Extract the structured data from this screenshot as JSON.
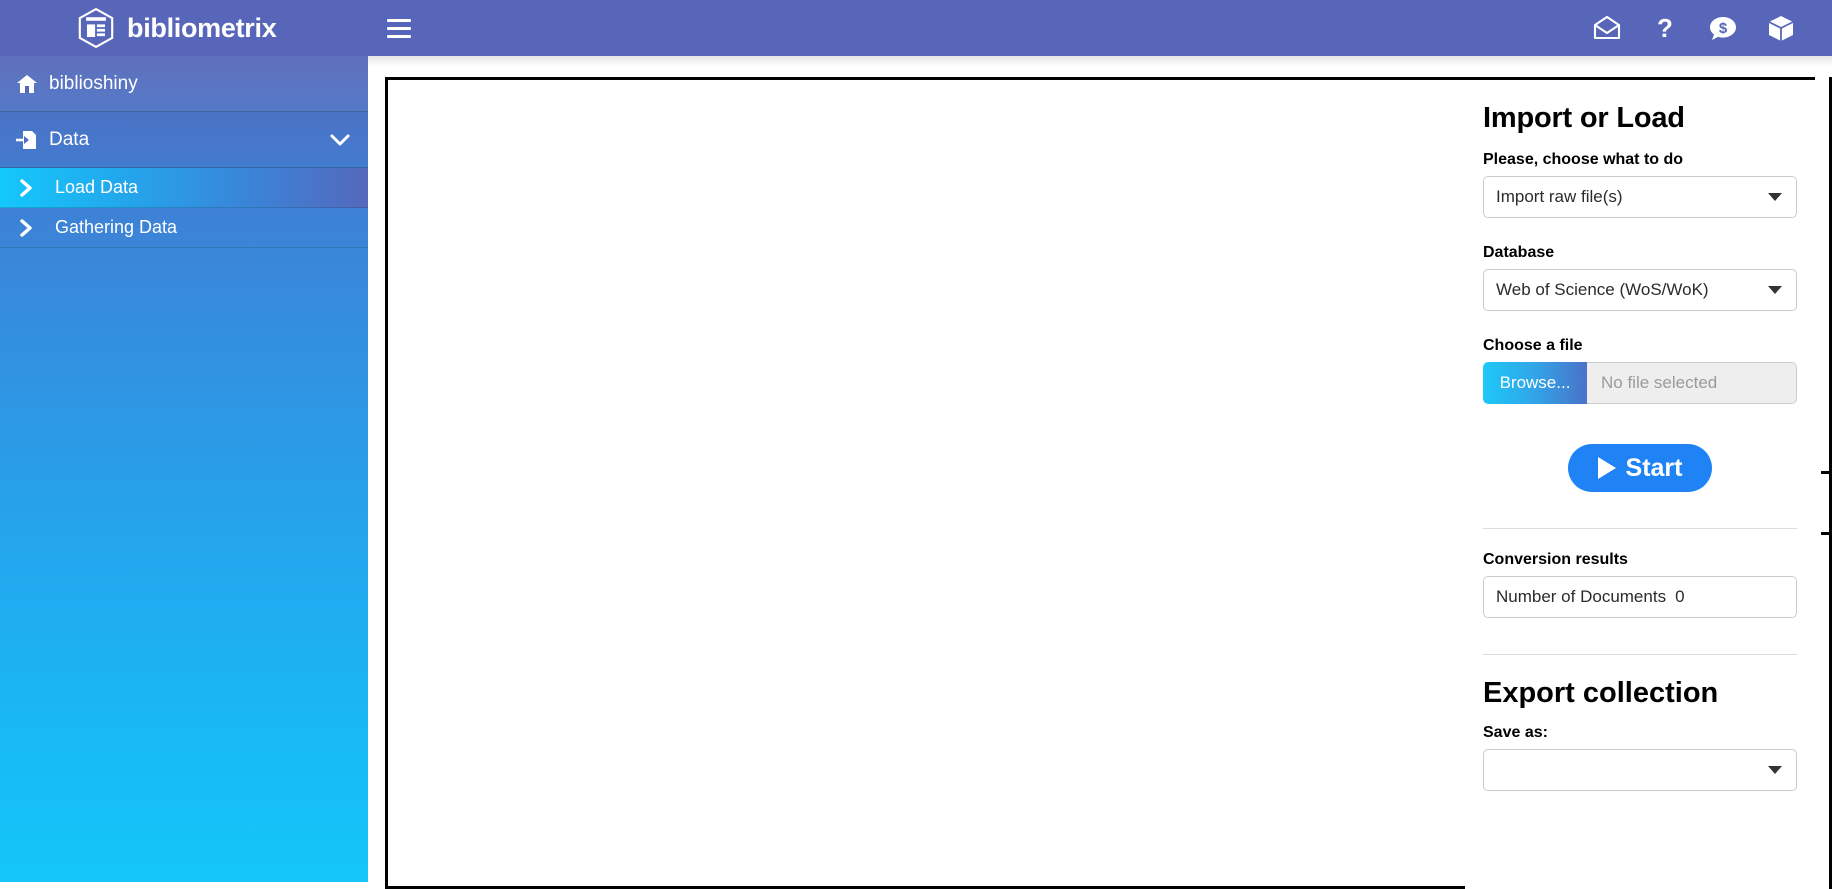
{
  "header": {
    "brand_title": "bibliometrix",
    "logo_icon": "bibliometrix-hex-logo",
    "menu_toggle_icon": "hamburger-icon",
    "icons": [
      {
        "name": "mail-icon",
        "label": "Mail"
      },
      {
        "name": "help-icon",
        "label": "?"
      },
      {
        "name": "donate-icon",
        "label": "Donate"
      },
      {
        "name": "package-icon",
        "label": "Package"
      }
    ]
  },
  "sidebar": {
    "items": [
      {
        "label": "biblioshiny",
        "icon": "home-icon",
        "type": "top",
        "active": false
      },
      {
        "label": "Data",
        "icon": "file-import-icon",
        "type": "top",
        "expanded": true,
        "chevron": "chevron-down-icon"
      }
    ],
    "submenu": [
      {
        "label": "Load Data",
        "icon": "chevron-right-icon",
        "active": true
      },
      {
        "label": "Gathering Data",
        "icon": "chevron-right-icon",
        "active": false
      }
    ]
  },
  "panel": {
    "title": "Import or Load",
    "action_label": "Please, choose what to do",
    "action_value": "Import raw file(s)",
    "database_label": "Database",
    "database_value": "Web of Science (WoS/WoK)",
    "file_label": "Choose a file",
    "browse_label": "Browse...",
    "file_placeholder": "No file selected",
    "start_label": "Start",
    "conversion_label": "Conversion results",
    "documents_label": "Number of Documents",
    "documents_value": "0",
    "export_title": "Export collection",
    "save_as_label": "Save as:",
    "save_as_value": ""
  },
  "colors": {
    "header_bg": "#5766b8",
    "sidebar_top": "#5667b9",
    "sidebar_bottom": "#14c6fa",
    "accent_cyan": "#14c8fb",
    "start_blue": "#1f83f5",
    "text_dark": "#000000"
  }
}
